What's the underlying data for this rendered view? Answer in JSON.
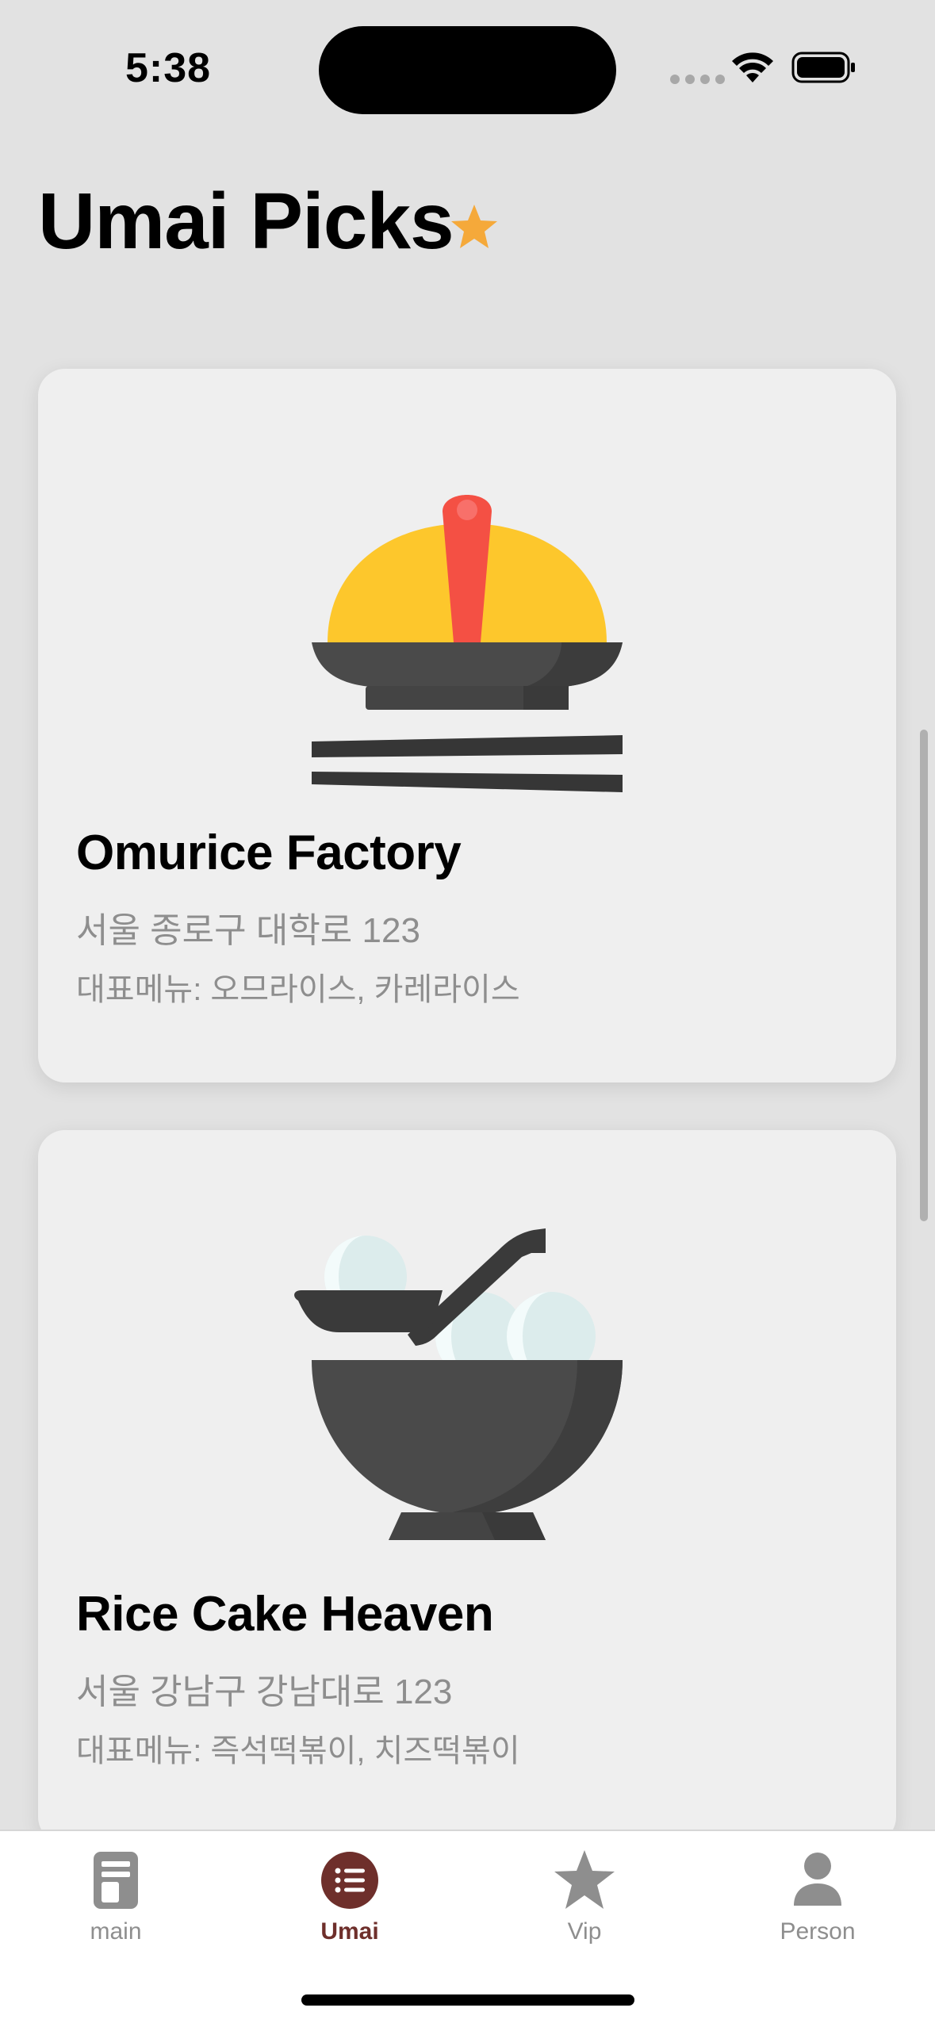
{
  "status_bar": {
    "time": "5:38"
  },
  "header": {
    "title": "Umai Picks",
    "title_icon": "star-icon",
    "accent_color": "#f5a93a"
  },
  "restaurants": [
    {
      "name": "Omurice Factory",
      "address": "서울 종로구 대학로 123",
      "menu": "대표메뉴: 오므라이스, 카레라이스",
      "image_icon": "omurice-bowl-icon"
    },
    {
      "name": "Rice Cake Heaven",
      "address": "서울 강남구 강남대로 123",
      "menu": "대표메뉴: 즉석떡볶이, 치즈떡볶이",
      "image_icon": "rice-cake-bowl-icon"
    }
  ],
  "tab_bar": {
    "active_color": "#6e2f2b",
    "items": [
      {
        "label": "main",
        "icon": "document-icon"
      },
      {
        "label": "Umai",
        "icon": "list-icon"
      },
      {
        "label": "Vip",
        "icon": "star-icon"
      },
      {
        "label": "Person",
        "icon": "person-icon"
      }
    ]
  }
}
